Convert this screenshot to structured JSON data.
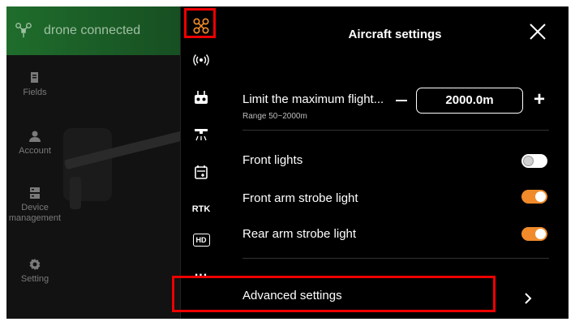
{
  "status_bar": {
    "text": "drone connected"
  },
  "sidebar": {
    "items": [
      {
        "label": "Fields",
        "icon": "fields-icon"
      },
      {
        "label": "Account",
        "icon": "account-icon"
      },
      {
        "label": "Device management",
        "icon": "device-icon"
      },
      {
        "label": "Setting",
        "icon": "gear-icon"
      }
    ]
  },
  "rail": {
    "rtk_label": "RTK",
    "hd_label": "HD",
    "more_label": "..."
  },
  "panel": {
    "title": "Aircraft settings",
    "limit_label": "Limit the maximum flight...",
    "limit_value": "2000.0m",
    "limit_range": "Range 50~2000m",
    "front_lights_label": "Front lights",
    "front_lights_on": false,
    "front_arm_label": "Front arm strobe light",
    "front_arm_on": true,
    "rear_arm_label": "Rear arm strobe light",
    "rear_arm_on": true,
    "advanced_label": "Advanced settings"
  },
  "colors": {
    "accent": "#f08a2a",
    "highlight": "#e00000",
    "status_bg": "#1f6d2c"
  }
}
